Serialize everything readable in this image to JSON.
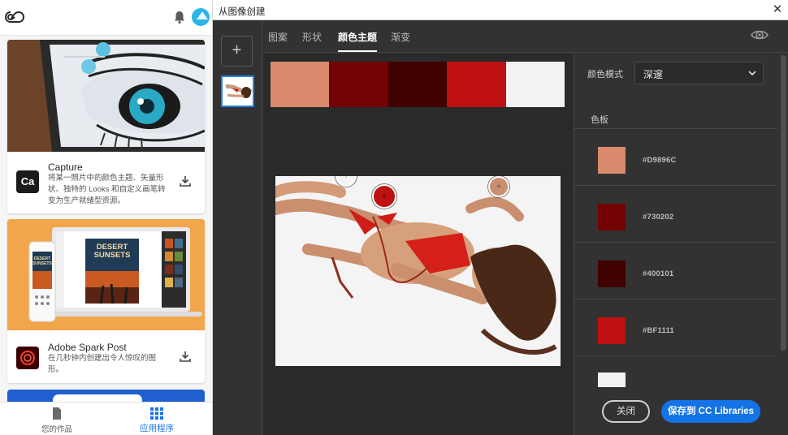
{
  "left_panel": {
    "cards": [
      {
        "app_name": "Capture",
        "icon_text": "Ca",
        "description": "将某一照片中的颜色主题、矢量形状、独特的 Looks 和自定义画笔转变为生产就绪型资源。"
      },
      {
        "app_name": "Adobe Spark Post",
        "description": "在几秒钟内创建出令人惊叹的图形。",
        "hero_text": "DESERT SUNSETS",
        "hero_small_text": "DESERT SUNSETS"
      }
    ],
    "bottom_tabs": {
      "my_work": "您的作品",
      "apps": "应用程序"
    }
  },
  "dialog": {
    "title": "从图像创建",
    "tabs": [
      "图案",
      "形状",
      "颜色主题",
      "渐变"
    ],
    "active_tab": "颜色主题",
    "color_mode_label": "颜色模式",
    "color_mode_value": "深邃",
    "palette_label": "色板",
    "swatches": [
      {
        "hex": "#D9896C",
        "color": "#D9896C"
      },
      {
        "hex": "#730202",
        "color": "#730202"
      },
      {
        "hex": "#400101",
        "color": "#400101"
      },
      {
        "hex": "#BF1111",
        "color": "#BF1111"
      },
      {
        "hex": "",
        "color": "#F2F2F2"
      }
    ],
    "close_button": "关闭",
    "save_button": "保存到 CC Libraries",
    "accent_color": "#1473E6"
  }
}
